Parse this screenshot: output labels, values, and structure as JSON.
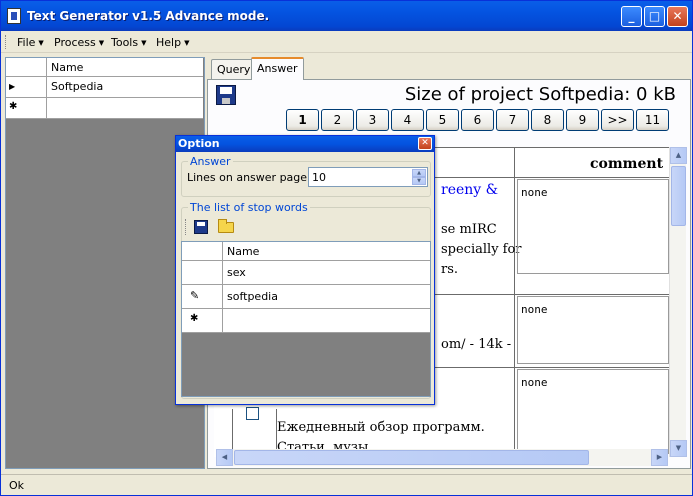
{
  "window": {
    "title": "Text Generator v1.5 Advance mode.",
    "controls": {
      "minimize": "_",
      "maximize": "□",
      "close": "✕"
    }
  },
  "menu": [
    {
      "label": "File"
    },
    {
      "label": "Process"
    },
    {
      "label": "Tools"
    },
    {
      "label": "Help"
    }
  ],
  "left_grid": {
    "header": "Name",
    "rows": [
      {
        "marker": "▶",
        "name": "Softpedia"
      },
      {
        "marker": "✱",
        "name": ""
      }
    ]
  },
  "tabs": [
    {
      "label": "Query",
      "active": false
    },
    {
      "label": "Answer",
      "active": true
    }
  ],
  "answer_panel": {
    "project_size": "Size of project Softpedia: 0 kB",
    "pages": [
      "1",
      "2",
      "3",
      "4",
      "5",
      "6",
      "7",
      "8",
      "9",
      ">>",
      "11"
    ],
    "current_page": "1",
    "doc": {
      "comment_header": "comment",
      "texts": {
        "t1": "reeny &",
        "t2": "se mIRC",
        "t3": "specially for",
        "t4": "rs.",
        "t5": "om/ - 14k -",
        "t6": "Ежедневный обзор программ.",
        "t7": "Статьи, музы"
      },
      "comments": [
        "none",
        "none",
        "none"
      ]
    }
  },
  "dialog": {
    "title": "Option",
    "close": "✕",
    "answer_group": {
      "legend": "Answer",
      "lines_label": "Lines on answer page:",
      "lines_value": "10"
    },
    "stop_group": {
      "legend": "The list of stop words",
      "header": "Name",
      "rows": [
        {
          "marker": "",
          "name": "sex"
        },
        {
          "marker": "✎",
          "name": "softpedia"
        },
        {
          "marker": "✱",
          "name": ""
        }
      ]
    }
  },
  "status": {
    "text": "Ok"
  },
  "colors": {
    "title_blue": "#0453e0",
    "link_blue": "#0000ee",
    "group_blue": "#0046d5"
  }
}
